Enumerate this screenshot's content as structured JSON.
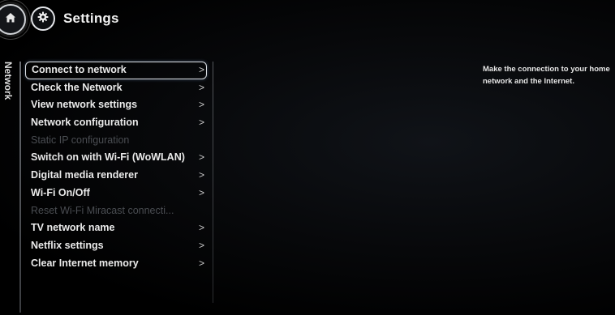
{
  "header": {
    "home_icon": "home-icon",
    "settings_icon": "gear-icon",
    "title": "Settings"
  },
  "sidebar": {
    "label": "Network"
  },
  "menu": {
    "items": [
      {
        "label": "Connect to network",
        "enabled": true,
        "selected": true,
        "chevron": ">"
      },
      {
        "label": "Check the Network",
        "enabled": true,
        "selected": false,
        "chevron": ">"
      },
      {
        "label": "View network settings",
        "enabled": true,
        "selected": false,
        "chevron": ">"
      },
      {
        "label": "Network configuration",
        "enabled": true,
        "selected": false,
        "chevron": ">"
      },
      {
        "label": "Static IP configuration",
        "enabled": false,
        "selected": false,
        "chevron": ""
      },
      {
        "label": "Switch on with Wi-Fi (WoWLAN)",
        "enabled": true,
        "selected": false,
        "chevron": ">"
      },
      {
        "label": "Digital media renderer",
        "enabled": true,
        "selected": false,
        "chevron": ">"
      },
      {
        "label": "Wi-Fi On/Off",
        "enabled": true,
        "selected": false,
        "chevron": ">"
      },
      {
        "label": "Reset Wi-Fi Miracast connecti...",
        "enabled": false,
        "selected": false,
        "chevron": ""
      },
      {
        "label": "TV network name",
        "enabled": true,
        "selected": false,
        "chevron": ">"
      },
      {
        "label": "Netflix settings",
        "enabled": true,
        "selected": false,
        "chevron": ">"
      },
      {
        "label": "Clear Internet memory",
        "enabled": true,
        "selected": false,
        "chevron": ">"
      }
    ]
  },
  "description": {
    "text": "Make the connection to your home network and the Internet."
  },
  "colors": {
    "background": "#000000",
    "text": "#eaeaea",
    "disabled_text": "#4a4d52",
    "focus_border": "#d9dde2"
  }
}
